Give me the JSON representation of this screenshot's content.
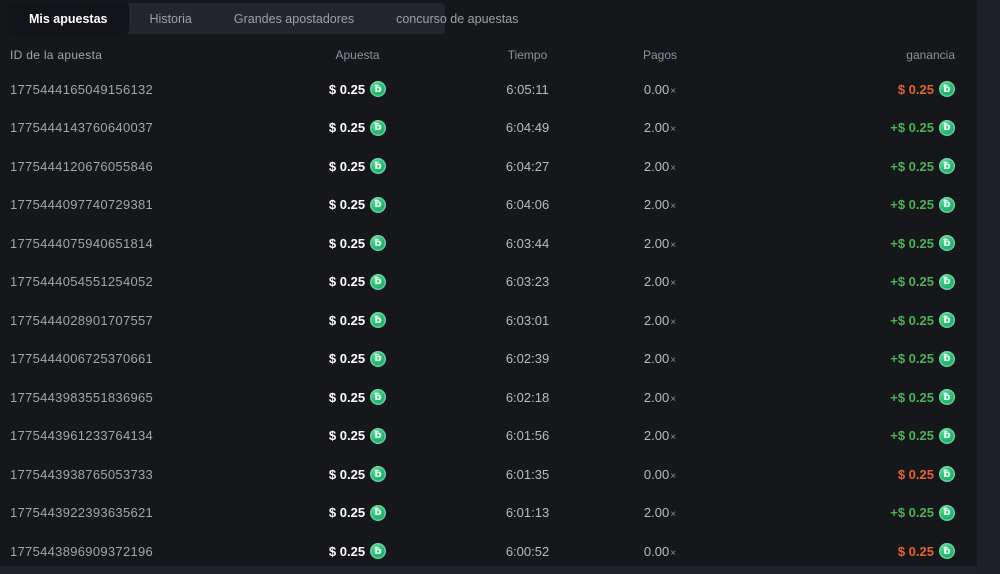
{
  "tabs": [
    {
      "label": "Mis apuestas",
      "active": true
    },
    {
      "label": "Historia",
      "active": false
    },
    {
      "label": "Grandes apostadores",
      "active": false
    },
    {
      "label": "concurso de apuestas",
      "active": false
    }
  ],
  "table": {
    "columns": [
      "ID de la apuesta",
      "Apuesta",
      "Tiempo",
      "Pagos",
      "ganancia"
    ],
    "payout_suffix": "×",
    "coin_glyph": "ƀ",
    "rows": [
      {
        "id": "1775444165049156132",
        "bet": "$ 0.25",
        "time": "6:05:11",
        "payout": "0.00",
        "profit": "$ 0.25",
        "win": false
      },
      {
        "id": "1775444143760640037",
        "bet": "$ 0.25",
        "time": "6:04:49",
        "payout": "2.00",
        "profit": "+$ 0.25",
        "win": true
      },
      {
        "id": "1775444120676055846",
        "bet": "$ 0.25",
        "time": "6:04:27",
        "payout": "2.00",
        "profit": "+$ 0.25",
        "win": true
      },
      {
        "id": "1775444097740729381",
        "bet": "$ 0.25",
        "time": "6:04:06",
        "payout": "2.00",
        "profit": "+$ 0.25",
        "win": true
      },
      {
        "id": "1775444075940651814",
        "bet": "$ 0.25",
        "time": "6:03:44",
        "payout": "2.00",
        "profit": "+$ 0.25",
        "win": true
      },
      {
        "id": "1775444054551254052",
        "bet": "$ 0.25",
        "time": "6:03:23",
        "payout": "2.00",
        "profit": "+$ 0.25",
        "win": true
      },
      {
        "id": "1775444028901707557",
        "bet": "$ 0.25",
        "time": "6:03:01",
        "payout": "2.00",
        "profit": "+$ 0.25",
        "win": true
      },
      {
        "id": "1775444006725370661",
        "bet": "$ 0.25",
        "time": "6:02:39",
        "payout": "2.00",
        "profit": "+$ 0.25",
        "win": true
      },
      {
        "id": "1775443983551836965",
        "bet": "$ 0.25",
        "time": "6:02:18",
        "payout": "2.00",
        "profit": "+$ 0.25",
        "win": true
      },
      {
        "id": "1775443961233764134",
        "bet": "$ 0.25",
        "time": "6:01:56",
        "payout": "2.00",
        "profit": "+$ 0.25",
        "win": true
      },
      {
        "id": "1775443938765053733",
        "bet": "$ 0.25",
        "time": "6:01:35",
        "payout": "0.00",
        "profit": "$ 0.25",
        "win": false
      },
      {
        "id": "1775443922393635621",
        "bet": "$ 0.25",
        "time": "6:01:13",
        "payout": "2.00",
        "profit": "+$ 0.25",
        "win": true
      },
      {
        "id": "1775443896909372196",
        "bet": "$ 0.25",
        "time": "6:00:52",
        "payout": "0.00",
        "profit": "$ 0.25",
        "win": false
      }
    ]
  },
  "colors": {
    "win": "#4cb158",
    "loss": "#e5632e",
    "coin": "#2cb877",
    "background": "#15171b"
  }
}
